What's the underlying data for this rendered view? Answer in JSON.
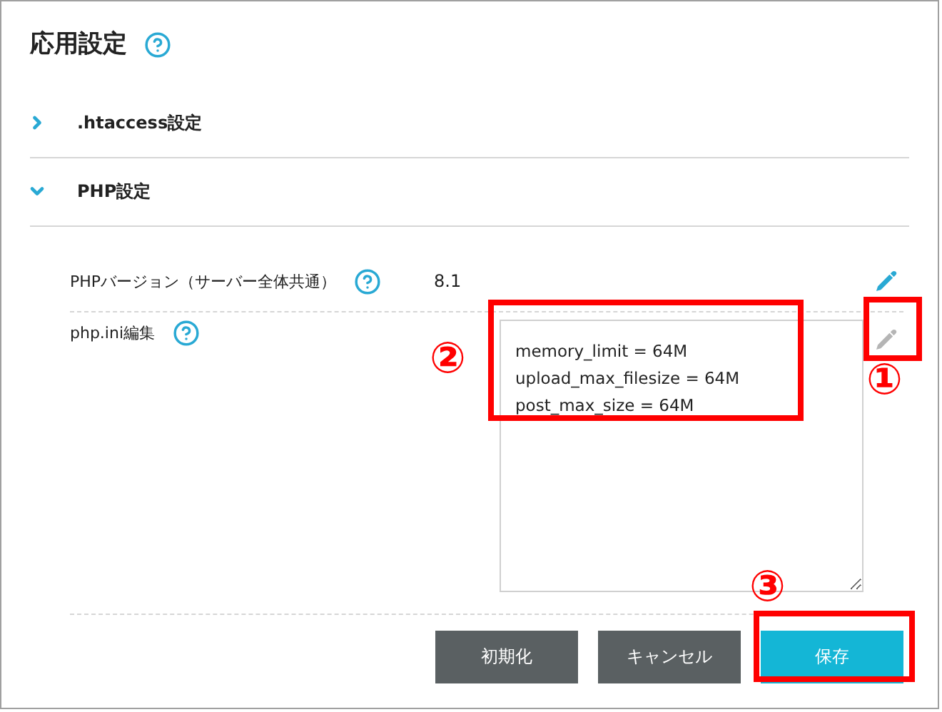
{
  "title": "応用設定",
  "sections": [
    {
      "label": ".htaccess設定",
      "expanded": false
    },
    {
      "label": "PHP設定",
      "expanded": true
    }
  ],
  "settings": [
    {
      "label": "PHPバージョン（サーバー全体共通）",
      "kind": "text",
      "value": "8.1",
      "edit_enabled": true
    },
    {
      "label": "php.ini編集",
      "kind": "textarea",
      "value": "memory_limit = 64M\nupload_max_filesize = 64M\npost_max_size = 64M",
      "edit_enabled": false,
      "field_annotation": "②",
      "edit_annotation": "①"
    }
  ],
  "buttons": [
    {
      "label": "初期化",
      "kind": "secondary"
    },
    {
      "label": "キャンセル",
      "kind": "secondary"
    },
    {
      "label": "保存",
      "kind": "primary",
      "annotation": "③"
    }
  ]
}
